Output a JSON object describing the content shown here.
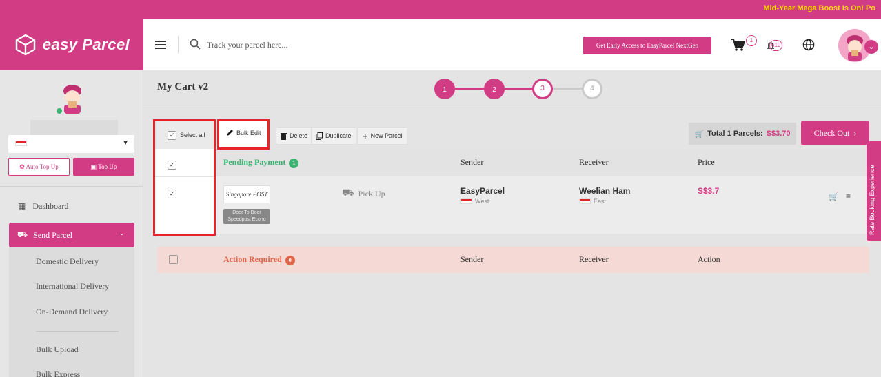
{
  "announcement": "Mid-Year Mega Boost Is On! Po",
  "header": {
    "brand": "easy Parcel",
    "search_placeholder": "Track your parcel here...",
    "nextgen_label": "Get Early Access to EasyParcel NextGen",
    "cart_count": "1",
    "notification_count": "610"
  },
  "sidebar": {
    "country_flag": "singapore-flag",
    "auto_topup_label": "Auto Top Up",
    "topup_label": "Top Up",
    "dashboard_label": "Dashboard",
    "send_parcel_label": "Send Parcel",
    "sub_items": [
      "Domestic Delivery",
      "International Delivery",
      "On-Demand Delivery",
      "Bulk Upload",
      "Bulk Express"
    ]
  },
  "main": {
    "title": "My Cart v2",
    "steps": [
      "1",
      "2",
      "3",
      "4"
    ],
    "current_step": 3,
    "toolbar": {
      "select_all": "Select all",
      "bulk_edit": "Bulk Edit",
      "delete": "Delete",
      "duplicate": "Duplicate",
      "new_parcel": "New Parcel"
    },
    "total_label": "Total 1 Parcels:",
    "total_amount": "S$3.70",
    "checkout_label": "Check Out",
    "pending": {
      "label": "Pending Payment",
      "count": "1",
      "col_sender": "Sender",
      "col_receiver": "Receiver",
      "col_price": "Price"
    },
    "row": {
      "courier_logo_text": "Singapore POST",
      "service": "Door To Door Speedpost Econo",
      "pickup": "Pick Up",
      "sender_name": "EasyParcel",
      "sender_region": "West",
      "receiver_name": "Weelian Ham",
      "receiver_region": "East",
      "price": "S$3.7"
    },
    "action_required": {
      "label": "Action Required",
      "count": "0",
      "col_sender": "Sender",
      "col_receiver": "Receiver",
      "col_action": "Action"
    }
  },
  "rate_tab_label": "Rate Booking Experience",
  "colors": {
    "brand": "#d23c85",
    "announce_text": "#ffdd00",
    "success": "#3cb371",
    "warning": "#e0664a",
    "highlight": "#e8242b"
  }
}
